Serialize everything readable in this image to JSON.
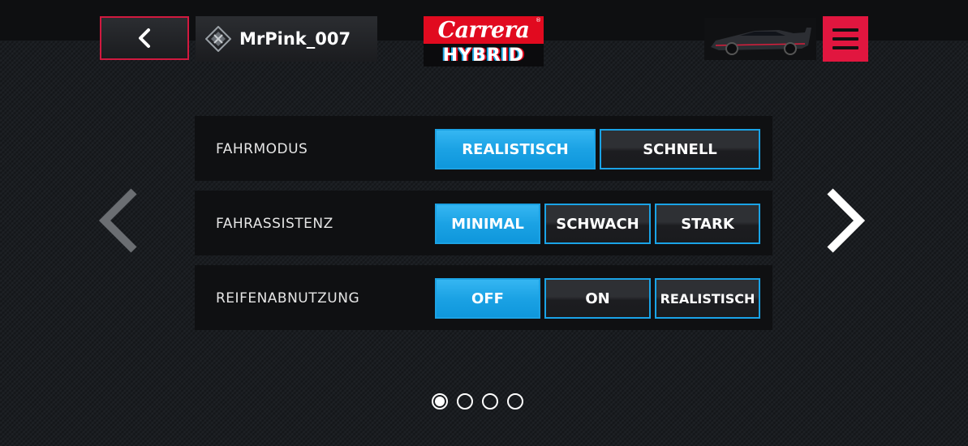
{
  "header": {
    "back_icon": "chevron-left-icon",
    "user_icon": "driver-badge-icon",
    "username": "MrPink_007",
    "logo_brand": "Carrera",
    "logo_sub": "HYBRID",
    "menu_icon": "hamburger-icon",
    "colors": {
      "accent": "#e1163f",
      "selected": "#1ba2e4"
    }
  },
  "settings": {
    "rows": [
      {
        "label": "FAHRMODUS",
        "options": [
          "REALISTISCH",
          "SCHNELL"
        ],
        "selected": "REALISTISCH"
      },
      {
        "label": "FAHRASSISTENZ",
        "options": [
          "MINIMAL",
          "SCHWACH",
          "STARK"
        ],
        "selected": "MINIMAL"
      },
      {
        "label": "REIFENABNUTZUNG",
        "options": [
          "OFF",
          "ON",
          "REALISTISCH"
        ],
        "selected": "OFF"
      }
    ]
  },
  "pager": {
    "total": 4,
    "current": 1
  }
}
